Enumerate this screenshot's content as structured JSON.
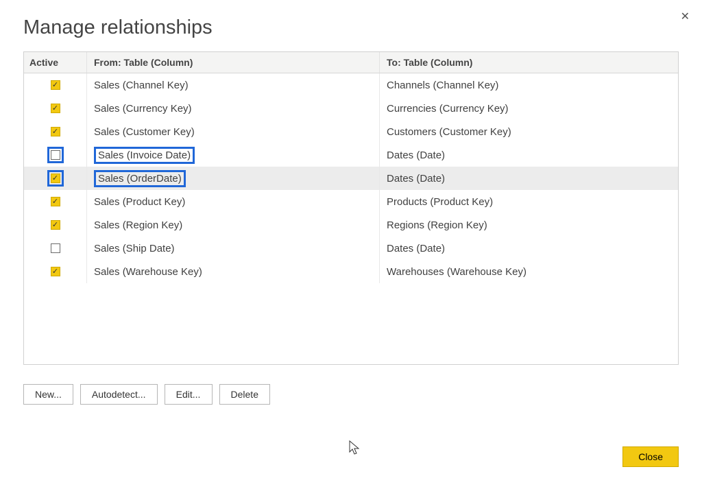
{
  "title": "Manage relationships",
  "columns": {
    "active": "Active",
    "from": "From: Table (Column)",
    "to": "To: Table (Column)"
  },
  "rows": [
    {
      "active": true,
      "from": "Sales (Channel Key)",
      "to": "Channels (Channel Key)",
      "selected": false,
      "hlFrom": false,
      "hlChk": false
    },
    {
      "active": true,
      "from": "Sales (Currency Key)",
      "to": "Currencies (Currency Key)",
      "selected": false,
      "hlFrom": false,
      "hlChk": false
    },
    {
      "active": true,
      "from": "Sales (Customer Key)",
      "to": "Customers (Customer Key)",
      "selected": false,
      "hlFrom": false,
      "hlChk": false
    },
    {
      "active": false,
      "from": "Sales (Invoice Date)",
      "to": "Dates (Date)",
      "selected": false,
      "hlFrom": true,
      "hlChk": true
    },
    {
      "active": true,
      "from": "Sales (OrderDate)",
      "to": "Dates (Date)",
      "selected": true,
      "hlFrom": true,
      "hlChk": true
    },
    {
      "active": true,
      "from": "Sales (Product Key)",
      "to": "Products (Product Key)",
      "selected": false,
      "hlFrom": false,
      "hlChk": false
    },
    {
      "active": true,
      "from": "Sales (Region Key)",
      "to": "Regions (Region Key)",
      "selected": false,
      "hlFrom": false,
      "hlChk": false
    },
    {
      "active": false,
      "from": "Sales (Ship Date)",
      "to": "Dates (Date)",
      "selected": false,
      "hlFrom": false,
      "hlChk": false
    },
    {
      "active": true,
      "from": "Sales (Warehouse Key)",
      "to": "Warehouses (Warehouse Key)",
      "selected": false,
      "hlFrom": false,
      "hlChk": false
    }
  ],
  "buttons": {
    "new": "New...",
    "autodetect": "Autodetect...",
    "edit": "Edit...",
    "delete": "Delete",
    "close": "Close"
  }
}
